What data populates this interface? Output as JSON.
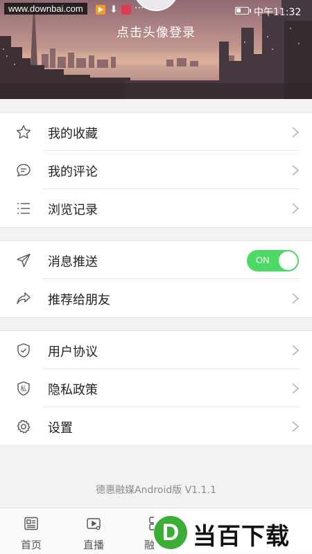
{
  "status_bar": {
    "watermark": "www.downbai.com",
    "time": "中午11:32"
  },
  "header": {
    "login_prompt": "点击头像登录"
  },
  "section1": {
    "items": [
      {
        "label": "我的收藏",
        "icon": "star-icon"
      },
      {
        "label": "我的评论",
        "icon": "comment-icon"
      },
      {
        "label": "浏览记录",
        "icon": "list-icon"
      }
    ]
  },
  "section2": {
    "items": [
      {
        "label": "消息推送",
        "icon": "send-icon",
        "toggle": "ON"
      },
      {
        "label": "推荐给朋友",
        "icon": "share-icon"
      }
    ]
  },
  "section3": {
    "items": [
      {
        "label": "用户协议",
        "icon": "shield-check-icon"
      },
      {
        "label": "隐私政策",
        "icon": "privacy-shield-icon",
        "icon_text": "私"
      },
      {
        "label": "设置",
        "icon": "gear-icon"
      }
    ]
  },
  "version": "德惠融媒Android版 V1.1.1",
  "tabbar": {
    "tabs": [
      {
        "label": "首页",
        "icon": "news-icon"
      },
      {
        "label": "直播",
        "icon": "live-icon"
      },
      {
        "label": "融",
        "icon": "grid-icon"
      }
    ]
  },
  "ad_overlay": {
    "logo_letter": "D",
    "text": "当百下载"
  },
  "colors": {
    "toggle_on": "#4cd964",
    "active_accent": "#e23a4f"
  }
}
